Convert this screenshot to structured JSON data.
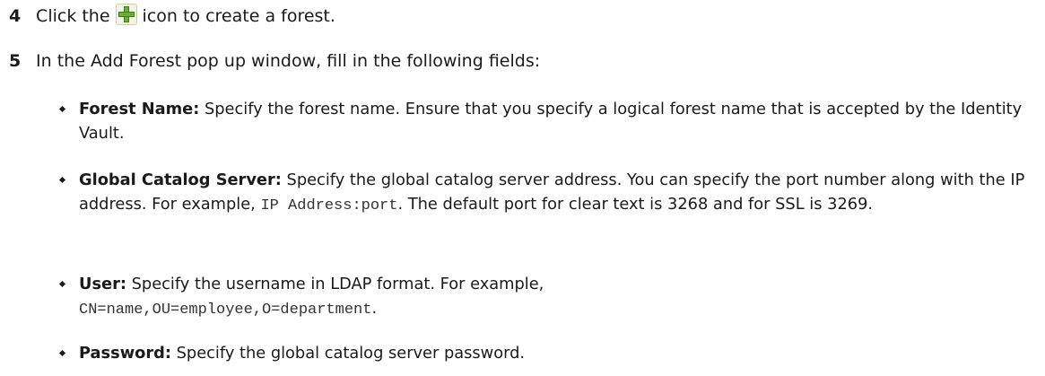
{
  "steps": [
    {
      "number": "4",
      "before": "Click the",
      "after": "icon to create a forest."
    },
    {
      "number": "5",
      "text": "In the Add Forest pop up window, fill in the following fields:"
    }
  ],
  "fields": [
    {
      "term": "Forest Name:",
      "desc": " Specify the forest name. Ensure that you specify a logical forest name that is accepted by the Identity Vault."
    },
    {
      "term": "Global Catalog Server:",
      "desc_a": "  Specify the global catalog server address. You can specify the port number along with the IP address. For example, ",
      "code": "IP Address:port",
      "desc_b": ". The default port for clear text is 3268 and for SSL is 3269."
    },
    {
      "term": "User:",
      "desc": "  Specify the username in LDAP format. For example,",
      "code": "CN=name,OU=employee,O=department",
      "code_after": "."
    },
    {
      "term": "Password:",
      "desc": "  Specify the global catalog server password."
    }
  ],
  "icons": {
    "add": "plus-icon"
  }
}
